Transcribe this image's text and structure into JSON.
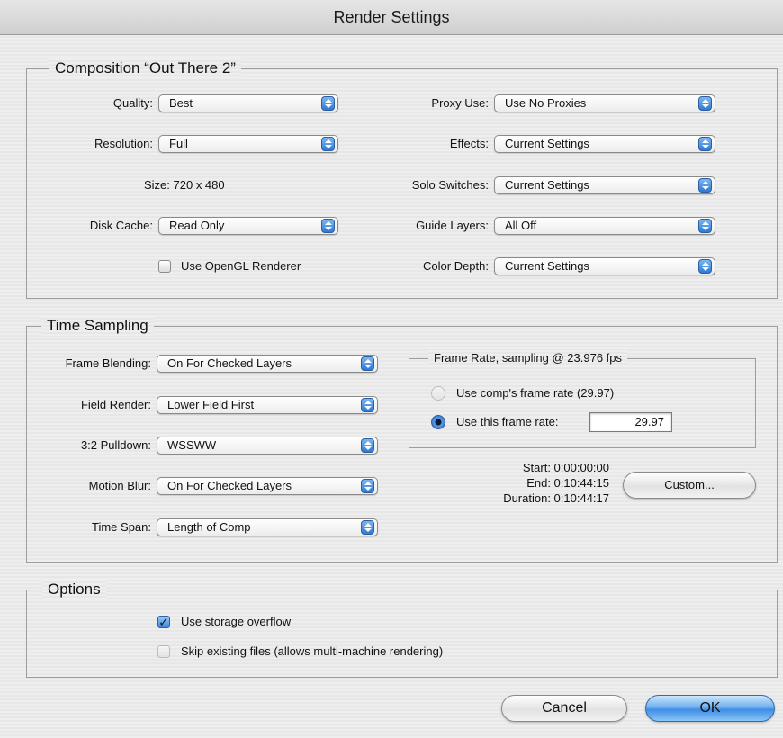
{
  "window": {
    "title": "Render Settings"
  },
  "composition": {
    "legend": "Composition “Out There 2”",
    "quality": {
      "label": "Quality:",
      "value": "Best"
    },
    "resolution": {
      "label": "Resolution:",
      "value": "Full"
    },
    "size": "Size: 720 x 480",
    "disk_cache": {
      "label": "Disk Cache:",
      "value": "Read Only"
    },
    "opengl": {
      "label": "Use OpenGL Renderer",
      "checked": false
    },
    "proxy_use": {
      "label": "Proxy Use:",
      "value": "Use No Proxies"
    },
    "effects": {
      "label": "Effects:",
      "value": "Current Settings"
    },
    "solo_switches": {
      "label": "Solo Switches:",
      "value": "Current Settings"
    },
    "guide_layers": {
      "label": "Guide Layers:",
      "value": "All Off"
    },
    "color_depth": {
      "label": "Color Depth:",
      "value": "Current Settings"
    }
  },
  "time_sampling": {
    "legend": "Time Sampling",
    "frame_blending": {
      "label": "Frame Blending:",
      "value": "On For Checked Layers"
    },
    "field_render": {
      "label": "Field Render:",
      "value": "Lower Field First"
    },
    "pulldown": {
      "label": "3:2 Pulldown:",
      "value": "WSSWW"
    },
    "motion_blur": {
      "label": "Motion Blur:",
      "value": "On For Checked Layers"
    },
    "time_span": {
      "label": "Time Span:",
      "value": "Length of Comp"
    },
    "frame_rate": {
      "legend": "Frame Rate, sampling @ 23.976 fps",
      "comp_rate": "Use comp's frame rate (29.97)",
      "this_rate": "Use this frame rate:",
      "this_rate_value": "29.97",
      "selected": "this_rate"
    },
    "start": "Start: 0:00:00:00",
    "end": "End: 0:10:44:15",
    "duration": "Duration: 0:10:44:17",
    "custom_button": "Custom..."
  },
  "options": {
    "legend": "Options",
    "storage_overflow": {
      "label": "Use storage overflow",
      "checked": true
    },
    "skip_existing": {
      "label": "Skip existing files (allows multi-machine rendering)",
      "checked": false,
      "enabled": false
    }
  },
  "buttons": {
    "cancel": "Cancel",
    "ok": "OK"
  },
  "colors": {
    "accent_blue": "#3d8ee6",
    "window_bg": "#ececec"
  }
}
